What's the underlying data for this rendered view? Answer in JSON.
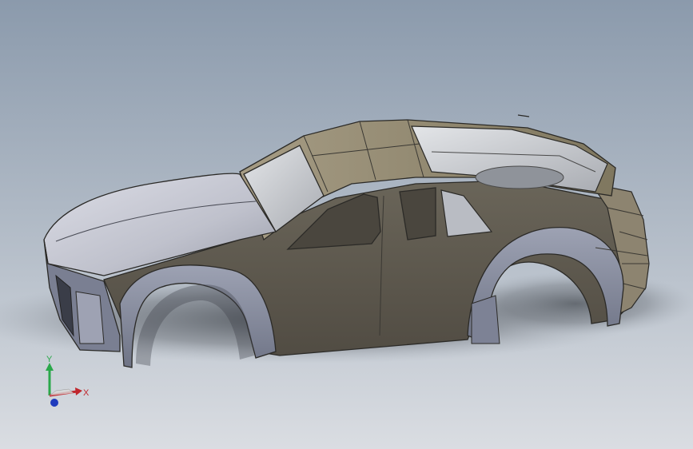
{
  "viewport": {
    "background_top": "#8e9dae",
    "background_bottom": "#d9dde2",
    "model": {
      "body_color": "#5f5a4f",
      "panel_color": "#8a8270",
      "fender_color": "#858a9c",
      "hood_color": "#c4c7d2",
      "glass_color": "#c9ccd0"
    }
  },
  "triad": {
    "x_label": "X",
    "y_label": "Y",
    "x_color": "#c0262d",
    "y_color": "#2aa84a",
    "z_color": "#1f3bbd"
  }
}
